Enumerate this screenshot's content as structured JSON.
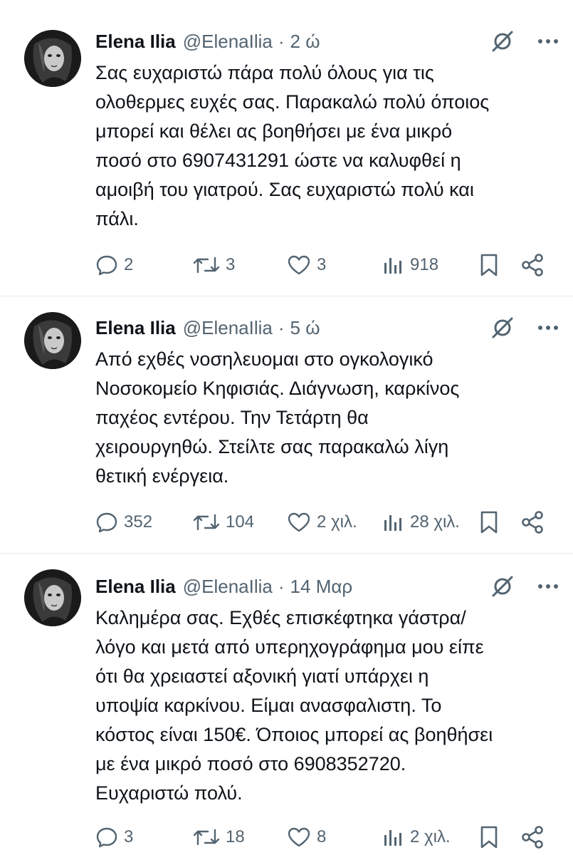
{
  "tweets": [
    {
      "author": {
        "name": "Elena Ilia",
        "handle": "@ElenaIlia"
      },
      "separator": "·",
      "time": "2 ώ",
      "lines": [
        "Σας ευχαριστώ πάρα πολύ όλους για τις",
        "ολοθερμες ευχές σας. Παρακαλώ πολύ όποιος",
        "μπορεί και θέλει ας βοηθήσει με ένα μικρό",
        "ποσό στο 6907431291 ώστε να καλυφθεί η",
        "αμοιβή του γιατρού. Σας ευχαριστώ πολύ και",
        "πάλι."
      ],
      "stats": {
        "replies": "2",
        "reposts": "3",
        "likes": "3",
        "views": "918"
      }
    },
    {
      "author": {
        "name": "Elena Ilia",
        "handle": "@ElenaIlia"
      },
      "separator": "·",
      "time": "5 ώ",
      "lines": [
        "Από εχθές νοσηλευομαι στο ογκολογικό",
        "Νοσοκομείο Κηφισιάς. Διάγνωση, καρκίνος",
        "παχέος εντέρου. Την Τετάρτη θα",
        "χειρουργηθώ. Στείλτε σας παρακαλώ λίγη",
        "θετική ενέργεια."
      ],
      "stats": {
        "replies": "352",
        "reposts": "104",
        "likes": "2 χιλ.",
        "views": "28 χιλ."
      }
    },
    {
      "author": {
        "name": "Elena Ilia",
        "handle": "@ElenaIlia"
      },
      "separator": "·",
      "time": "14 Μαρ",
      "lines": [
        "Καλημέρα σας. Εχθές επισκέφτηκα γάστρα/",
        "λόγο και μετά από υπερηχογράφημα μου είπε",
        "ότι θα χρειαστεί αξονική γιατί υπάρχει η",
        "υποψία καρκίνου. Είμαι ανασφαλιστη. Το",
        "κόστος είναι 150€. Όποιος μπορεί ας βοηθήσει",
        "με ένα μικρό ποσό στο 6908352720.",
        "Ευχαριστώ πολύ."
      ],
      "stats": {
        "replies": "3",
        "reposts": "18",
        "likes": "8",
        "views": "2 χιλ."
      }
    }
  ],
  "icons": {
    "reply": "reply-icon",
    "repost": "repost-icon",
    "like": "like-icon",
    "views": "views-icon",
    "bookmark": "bookmark-icon",
    "share": "share-icon",
    "grok": "grok-icon",
    "more": "more-icon"
  },
  "colors": {
    "text": "#0f1419",
    "muted": "#536471",
    "divider": "#e6e9ec"
  }
}
